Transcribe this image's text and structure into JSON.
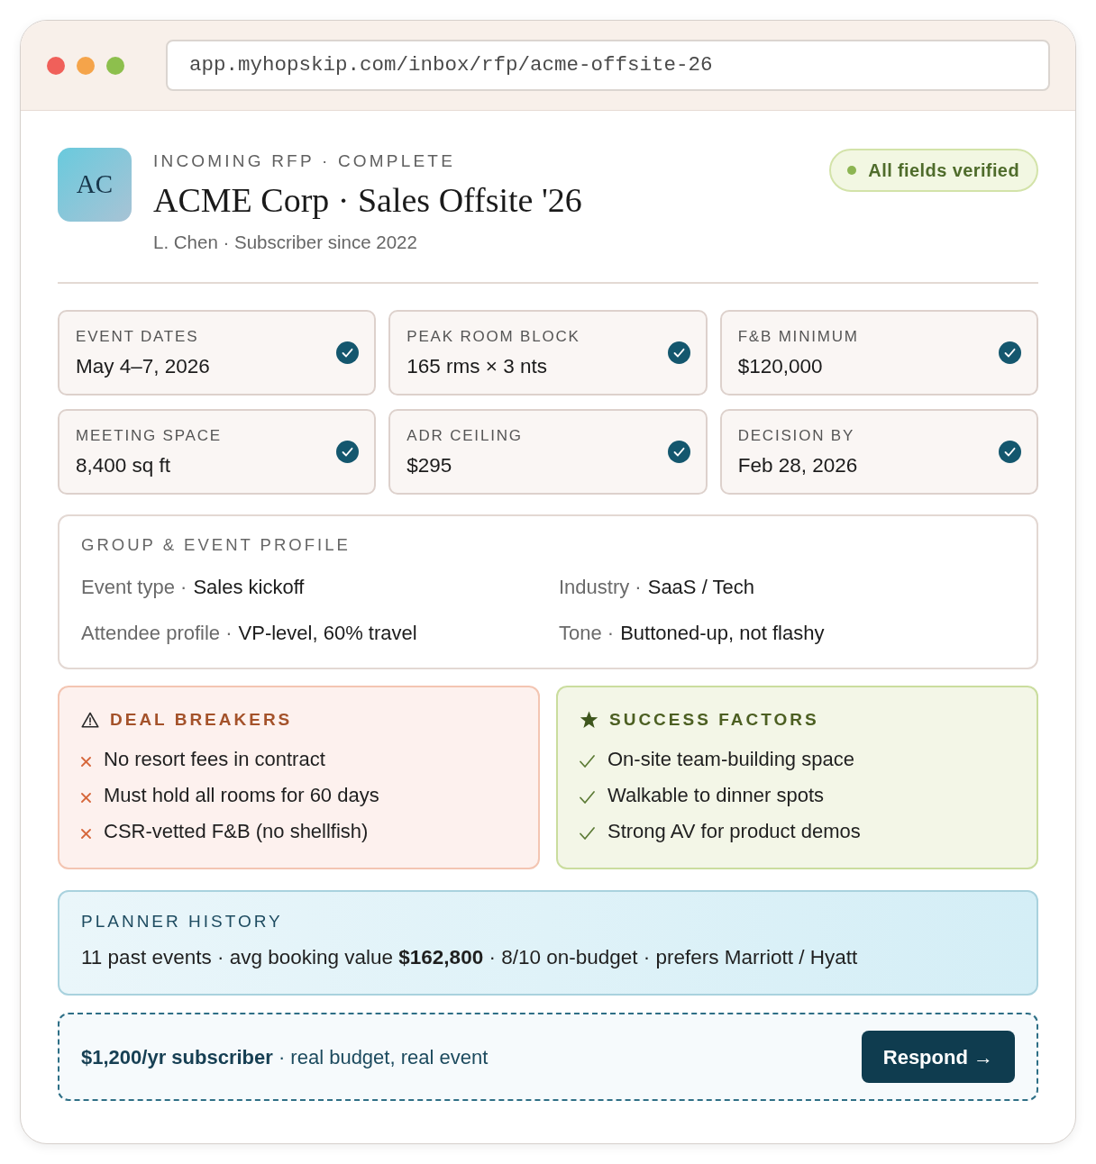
{
  "browser": {
    "url": "app.myhopskip.com/inbox/rfp/acme-offsite-26"
  },
  "header": {
    "avatar_initials": "AC",
    "eyebrow": "INCOMING RFP · COMPLETE",
    "title": "ACME Corp · Sales Offsite '26",
    "subtitle": "L. Chen · Subscriber since 2022",
    "status_badge": "All fields verified"
  },
  "stats": [
    {
      "label": "EVENT DATES",
      "value": "May 4–7, 2026",
      "verified": true
    },
    {
      "label": "PEAK ROOM BLOCK",
      "value": "165 rms × 3 nts",
      "verified": true
    },
    {
      "label": "F&B MINIMUM",
      "value": "$120,000",
      "verified": true
    },
    {
      "label": "MEETING SPACE",
      "value": "8,400 sq ft",
      "verified": true
    },
    {
      "label": "ADR CEILING",
      "value": "$295",
      "verified": true
    },
    {
      "label": "DECISION BY",
      "value": "Feb 28, 2026",
      "verified": true
    }
  ],
  "profile": {
    "title": "GROUP & EVENT PROFILE",
    "fields": [
      {
        "label": "Event type ·",
        "value": "Sales kickoff"
      },
      {
        "label": "Industry ·",
        "value": "SaaS / Tech"
      },
      {
        "label": "Attendee profile ·",
        "value": "VP-level, 60% travel"
      },
      {
        "label": "Tone ·",
        "value": "Buttoned-up, not flashy"
      }
    ]
  },
  "lists": [
    {
      "kind": "negative",
      "title": "DEAL BREAKERS",
      "items": [
        "No resort fees in contract",
        "Must hold all rooms for 60 days",
        "CSR-vetted F&B (no shellfish)"
      ]
    },
    {
      "kind": "positive",
      "title": "SUCCESS FACTORS",
      "items": [
        "On-site team-building space",
        "Walkable to dinner spots",
        "Strong AV for product demos"
      ]
    }
  ],
  "planner_history": {
    "title": "PLANNER HISTORY",
    "text": "11 past events · avg booking value **$162,800** · 8/10 on-budget · prefers Marriott / Hyatt"
  },
  "footer": {
    "text": "**$1,200/yr subscriber** · real budget, real event",
    "button": "Respond →"
  }
}
